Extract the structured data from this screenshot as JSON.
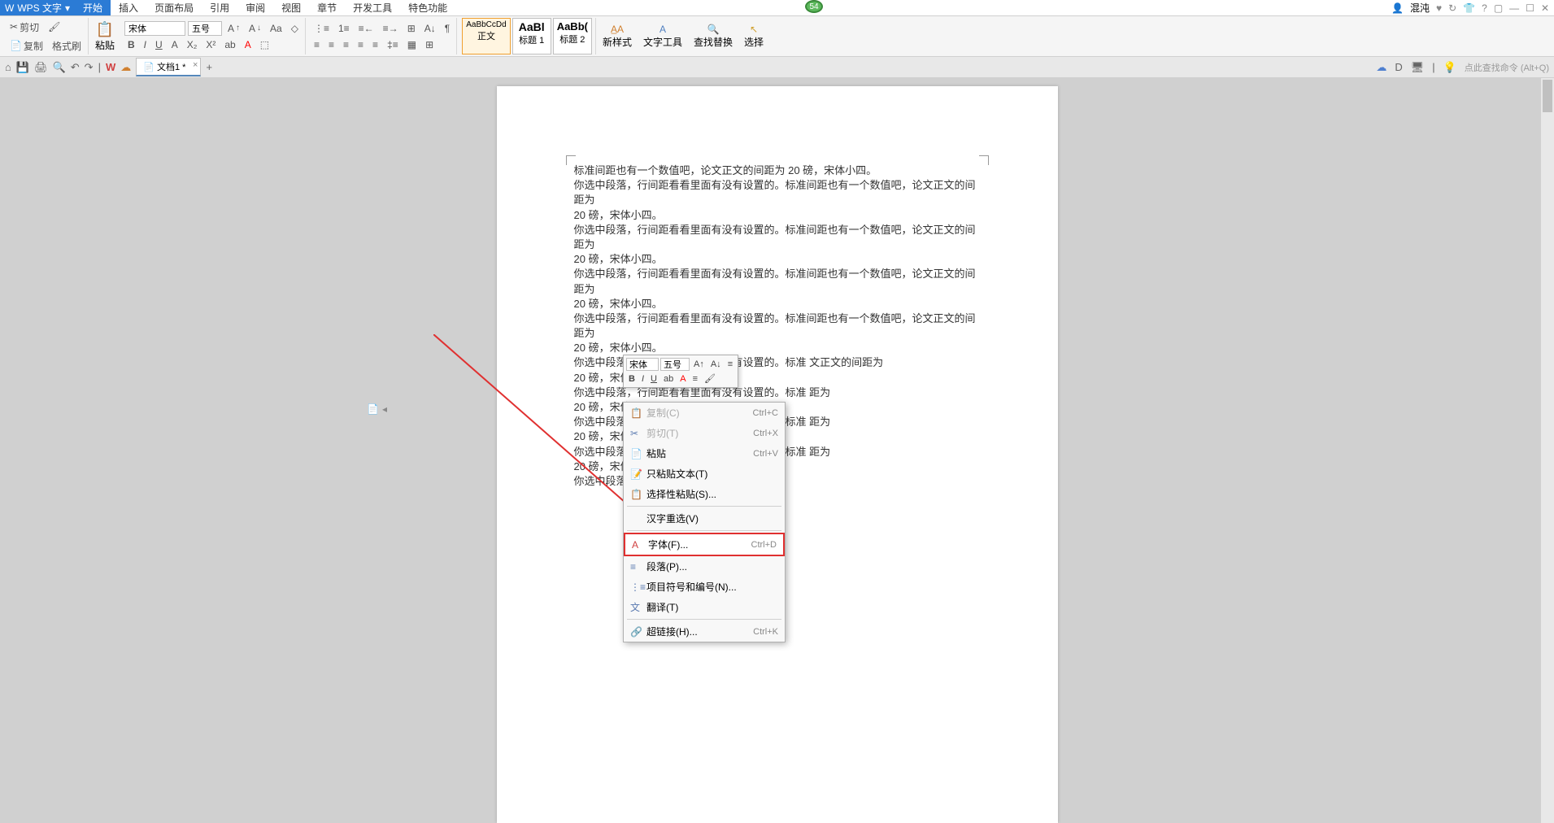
{
  "app": {
    "name": "WPS 文字",
    "dropdown": "▾"
  },
  "tabs": {
    "items": [
      "开始",
      "插入",
      "页面布局",
      "引用",
      "审阅",
      "视图",
      "章节",
      "开发工具",
      "特色功能"
    ],
    "active_index": 0
  },
  "title_right": {
    "username": "混沌",
    "badge": "54"
  },
  "ribbon": {
    "paste_group": {
      "cut": "剪切",
      "copy": "复制",
      "paste": "粘贴",
      "format_painter": "格式刷"
    },
    "font": {
      "name": "宋体",
      "size": "五号",
      "bold": "B",
      "italic": "I",
      "underline": "U",
      "strike": "A"
    },
    "styles": {
      "normal": {
        "preview": "AaBbCcDd",
        "label": "正文"
      },
      "heading1": {
        "preview": "AaBl",
        "label": "标题 1"
      },
      "heading2": {
        "preview": "AaBb(",
        "label": "标题 2"
      }
    },
    "new_style": "新样式",
    "text_tools": "文字工具",
    "find_replace": "查找替换",
    "select": "选择"
  },
  "quick_bar": {
    "doc_tab": "文档1 *",
    "search_hint": "点此查找命令 (Alt+Q)"
  },
  "document": {
    "lines": [
      "标准间距也有一个数值吧，论文正文的间距为 20 磅，宋体小四。",
      "你选中段落，行间距看看里面有没有设置的。标准间距也有一个数值吧，论文正文的间距为",
      "20 磅，宋体小四。",
      "你选中段落，行间距看看里面有没有设置的。标准间距也有一个数值吧，论文正文的间距为",
      "20 磅，宋体小四。",
      "你选中段落，行间距看看里面有没有设置的。标准间距也有一个数值吧，论文正文的间距为",
      "20 磅，宋体小四。",
      "你选中段落，行间距看看里面有没有设置的。标准间距也有一个数值吧，论文正文的间距为",
      "20 磅，宋体小四。",
      "你选中段落，行间距看看里面有没有设置的。标准               文正文的间距为",
      "20 磅，宋体小四。",
      "你选中段落，行间距看看里面有没有设置的。标准                                              距为",
      "20 磅，宋体小四。",
      "你选中段落，行间距看看里面有没有设置的。标准                                              距为",
      "20 磅，宋体小四。",
      "你选中段落，行间距看看里面有没有设置的。标准                                              距为",
      "20 磅，宋体小四。",
      "你选中段落，行间距看看里面有没有设置的。"
    ]
  },
  "mini_toolbar": {
    "font": "宋体",
    "size": "五号"
  },
  "context_menu": {
    "items": [
      {
        "icon": "📋",
        "label": "复制(C)",
        "shortcut": "Ctrl+C",
        "disabled": true
      },
      {
        "icon": "✂",
        "label": "剪切(T)",
        "shortcut": "Ctrl+X",
        "disabled": true
      },
      {
        "icon": "📄",
        "label": "粘贴",
        "shortcut": "Ctrl+V"
      },
      {
        "icon": "📝",
        "label": "只粘贴文本(T)",
        "shortcut": ""
      },
      {
        "icon": "📋",
        "label": "选择性粘贴(S)...",
        "shortcut": ""
      },
      {
        "sep": true
      },
      {
        "icon": "",
        "label": "汉字重选(V)",
        "shortcut": ""
      },
      {
        "sep": true
      },
      {
        "icon": "A",
        "label": "字体(F)...",
        "shortcut": "Ctrl+D",
        "highlighted": true
      },
      {
        "icon": "≡",
        "label": "段落(P)...",
        "shortcut": ""
      },
      {
        "icon": "⋮≡",
        "label": "项目符号和编号(N)...",
        "shortcut": ""
      },
      {
        "icon": "文",
        "label": "翻译(T)",
        "shortcut": ""
      },
      {
        "sep": true
      },
      {
        "icon": "🔗",
        "label": "超链接(H)...",
        "shortcut": "Ctrl+K"
      }
    ]
  }
}
